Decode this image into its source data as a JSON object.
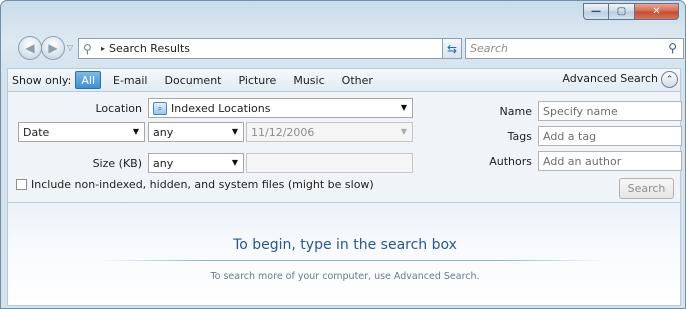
{
  "window": {
    "caption_buttons": [
      {
        "name": "minimize",
        "glyph": "—"
      },
      {
        "name": "maximize",
        "glyph": "▢"
      },
      {
        "name": "close",
        "glyph": "✕"
      }
    ]
  },
  "nav": {
    "back_icon": "◀",
    "forward_icon": "▶",
    "recent_icon": "▽"
  },
  "address": {
    "icon": "search-icon",
    "separator": "▸",
    "path": "Search Results",
    "dropdown_glyph": "▾"
  },
  "refresh": {
    "glyph": "⇆"
  },
  "search": {
    "placeholder": "Search",
    "glass_glyph": "⚲"
  },
  "show_only": {
    "label": "Show only:",
    "chips": [
      "All",
      "E-mail",
      "Document",
      "Picture",
      "Music",
      "Other"
    ],
    "active_chip": "All",
    "advanced_label": "Advanced Search",
    "advanced_glyph": "⌃"
  },
  "advanced": {
    "location_label": "Location",
    "location_value": "Indexed Locations",
    "date_field": "Date",
    "date_qualifier": "any",
    "date_value": "11/12/2006",
    "size_label": "Size (KB)",
    "size_qualifier": "any",
    "name_label": "Name",
    "name_placeholder": "Specify name",
    "tags_label": "Tags",
    "tags_placeholder": "Add a tag",
    "authors_label": "Authors",
    "authors_placeholder": "Add an author",
    "include_label": "Include non-indexed, hidden, and system files (might be slow)",
    "include_checked": false,
    "search_button": "Search"
  },
  "results": {
    "title": "To begin, type in the search box",
    "subtitle": "To search more of your computer, use Advanced Search."
  },
  "colors": {
    "accent": "#3d8fd0",
    "title_text": "#2a5694",
    "close_button": "#c24a2f"
  }
}
